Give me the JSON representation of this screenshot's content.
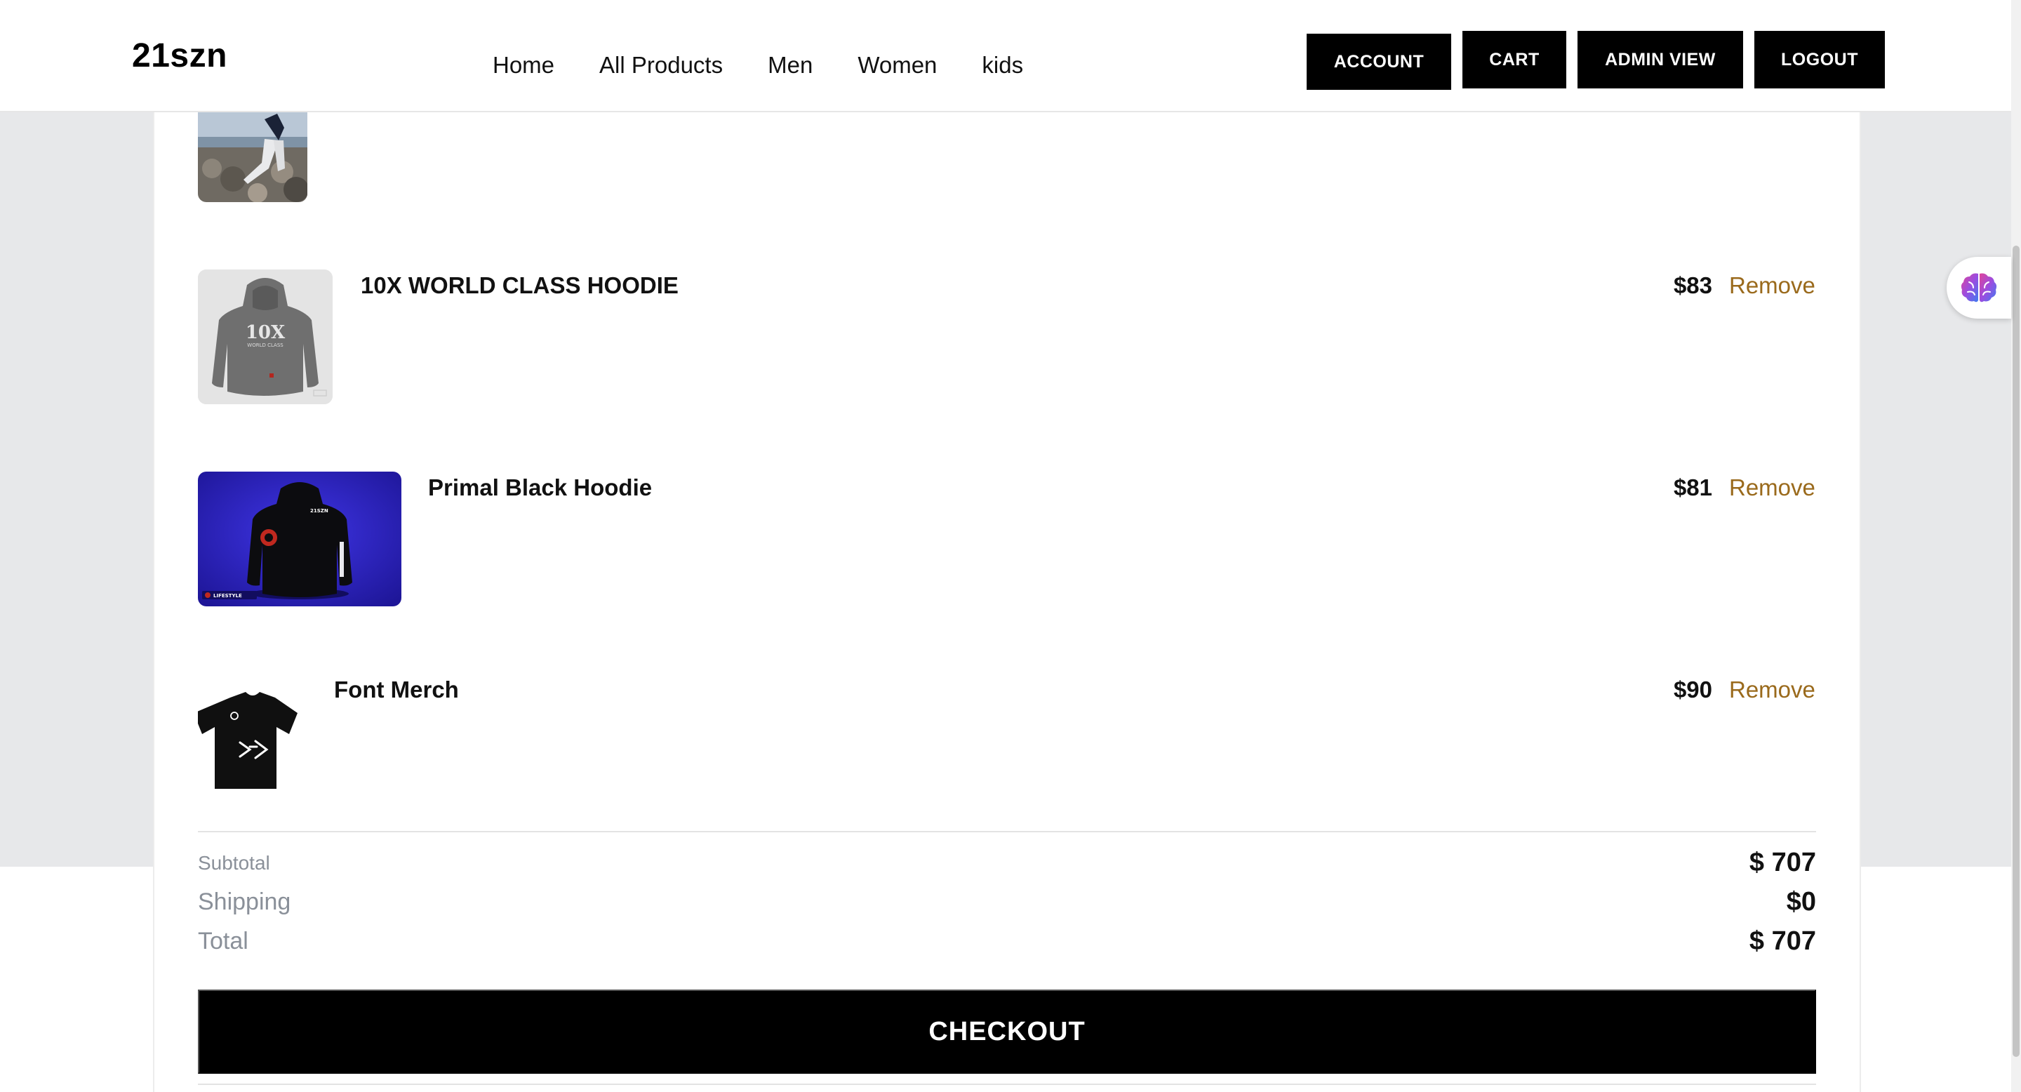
{
  "brand": "21szn",
  "nav": [
    "Home",
    "All Products",
    "Men",
    "Women",
    "kids"
  ],
  "header_buttons": {
    "account": "ACCOUNT",
    "cart": "CART",
    "admin": "ADMIN VIEW",
    "logout": "LOGOUT"
  },
  "cart": {
    "items": [
      {
        "name": "10X WORLD CLASS HOODIE",
        "price": "$83",
        "remove": "Remove",
        "thumb_text": "10X",
        "thumb_subtext": "WORLD CLASS"
      },
      {
        "name": "Primal Black Hoodie",
        "price": "$81",
        "remove": "Remove",
        "thumb_text": "21SZN",
        "thumb_badge": "LIFESTYLE"
      },
      {
        "name": "Font Merch",
        "price": "$90",
        "remove": "Remove"
      }
    ],
    "summary": {
      "subtotal_label": "Subtotal",
      "subtotal": "$ 707",
      "shipping_label": "Shipping",
      "shipping": "$0",
      "total_label": "Total",
      "total": "$ 707"
    },
    "checkout_label": "CHECKOUT"
  },
  "colors": {
    "accent_remove": "#9a6a1c",
    "button_bg": "#000000",
    "backdrop": "#e7e8ea",
    "thumb_blue": "#2a1fc4"
  },
  "icons": [
    "brain-icon"
  ]
}
